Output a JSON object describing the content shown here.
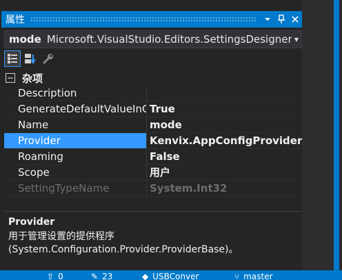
{
  "titlebar": {
    "title": "属性",
    "buttons": {
      "dropdown": "▾",
      "pin": "📌",
      "close": "✕"
    }
  },
  "selector": {
    "object_name": "mode",
    "object_type": "Microsoft.VisualStudio.Editors.SettingsDesigner.D",
    "dropdown_icon": "chevron-down-icon"
  },
  "toolbar": {
    "tools": [
      "categorized-icon",
      "alphabetical-icon",
      "property-pages-icon"
    ]
  },
  "category": {
    "collapse_glyph": "⊟",
    "label": "杂项"
  },
  "properties": [
    {
      "name": "Description",
      "value": ""
    },
    {
      "name": "GenerateDefaultValueInCode",
      "value": "True"
    },
    {
      "name": "Name",
      "value": "mode"
    },
    {
      "name": "Provider",
      "value": "Kenvix.AppConfigProvider"
    },
    {
      "name": "Roaming",
      "value": "False"
    },
    {
      "name": "Scope",
      "value": "用户"
    },
    {
      "name": "SettingTypeName",
      "value": "System.Int32"
    }
  ],
  "selected_property": "Provider",
  "readonly_property": "SettingTypeName",
  "description": {
    "title": "Provider",
    "line1": "用于管理设置的提供程序",
    "line2": "(System.Configuration.Provider.ProviderBase)。"
  },
  "statusbar": {
    "items": [
      {
        "icon": "arrow-up-icon",
        "text": "0"
      },
      {
        "icon": "pencil-icon",
        "text": "23"
      },
      {
        "icon": "repo-icon",
        "text": "USBConver"
      },
      {
        "icon": "branch-icon",
        "text": "master"
      }
    ]
  },
  "colors": {
    "accent": "#007acc",
    "selection": "#3399ff",
    "background": "#252526"
  }
}
